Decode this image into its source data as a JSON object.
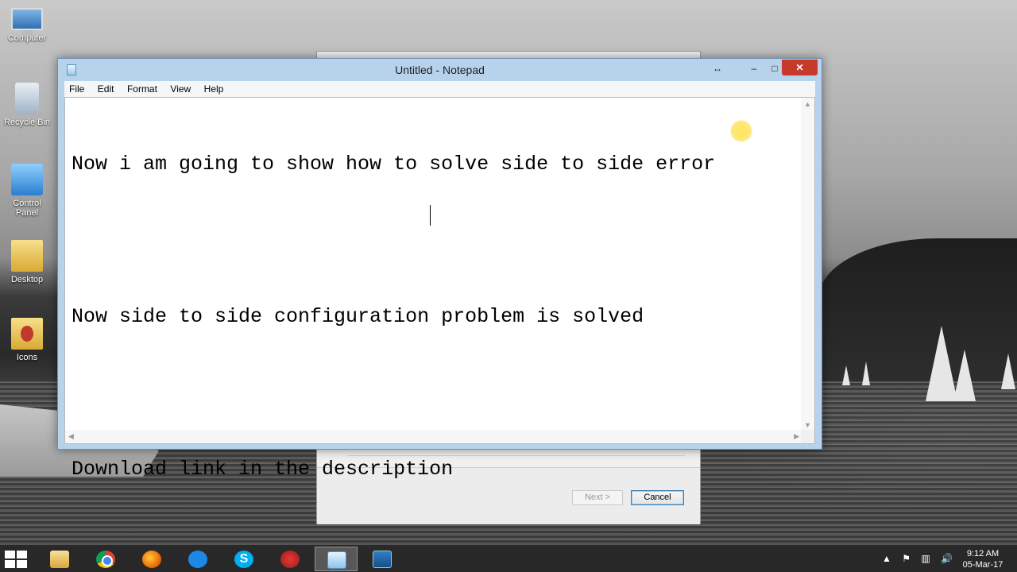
{
  "desktop": {
    "icons": [
      {
        "label": "Computer",
        "icon": "computer-icon"
      },
      {
        "label": "Recycle Bin",
        "icon": "recycle-bin-icon"
      },
      {
        "label": "Control Panel",
        "icon": "control-panel-icon"
      },
      {
        "label": "Desktop",
        "icon": "folder-icon"
      },
      {
        "label": "Icons",
        "icon": "folder-icon"
      }
    ]
  },
  "wizard": {
    "next_label": "Next >",
    "cancel_label": "Cancel"
  },
  "notepad": {
    "title": "Untitled - Notepad",
    "titlebar_buttons": {
      "resize": "↔",
      "minimize": "–",
      "maximize": "□",
      "close": "✕"
    },
    "menu": [
      "File",
      "Edit",
      "Format",
      "View",
      "Help"
    ],
    "lines": [
      "Now i am going to show how to solve side to side error",
      "",
      "Now side to side configuration problem is solved",
      "",
      "Download link in the description"
    ]
  },
  "taskbar": {
    "apps": [
      {
        "name": "file-explorer",
        "active": false
      },
      {
        "name": "chrome",
        "active": false
      },
      {
        "name": "firefox",
        "active": false
      },
      {
        "name": "sync",
        "active": false
      },
      {
        "name": "skype",
        "active": false
      },
      {
        "name": "downloader",
        "active": false
      },
      {
        "name": "notepad",
        "active": true
      },
      {
        "name": "setup",
        "active": false
      }
    ],
    "skype_glyph": "S",
    "tray_symbols": [
      "▲",
      "⚑",
      "▥",
      "🔊"
    ],
    "time": "9:12 AM",
    "date": "05-Mar-17"
  },
  "colors": {
    "window_frame": "#b7d3ec",
    "close_button": "#c7392b",
    "taskbar": "#282828"
  }
}
